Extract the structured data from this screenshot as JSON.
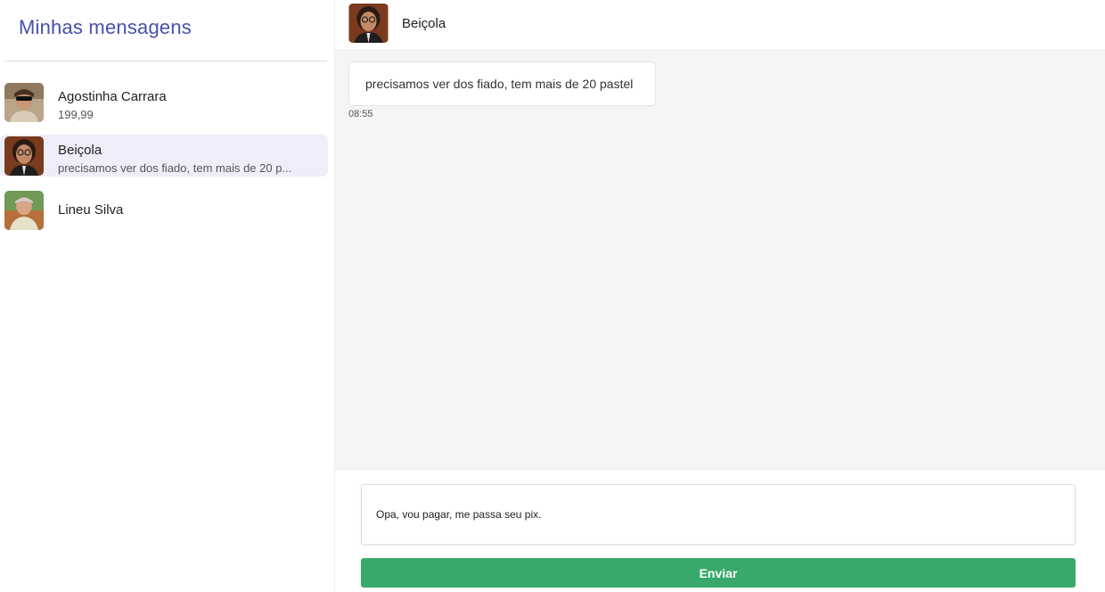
{
  "sidebar": {
    "title": "Minhas mensagens",
    "conversations": [
      {
        "name": "Agostinha Carrara",
        "preview": "199,99",
        "active": false
      },
      {
        "name": "Beiçola",
        "preview": "precisamos ver dos fiado, tem mais de 20 p...",
        "active": true
      },
      {
        "name": "Lineu Silva",
        "preview": "",
        "active": false
      }
    ]
  },
  "chat": {
    "contact_name": "Beiçola",
    "messages": [
      {
        "text": "precisamos ver dos fiado, tem mais de 20 pastel",
        "time": "08:55"
      }
    ],
    "composer": {
      "value": "Opa, vou pagar, me passa seu pix.",
      "send_label": "Enviar"
    }
  },
  "colors": {
    "accent": "#4a4fa8",
    "active_row": "#edeef9",
    "send_button": "#38a96b",
    "chat_background": "#f4f5f7"
  }
}
